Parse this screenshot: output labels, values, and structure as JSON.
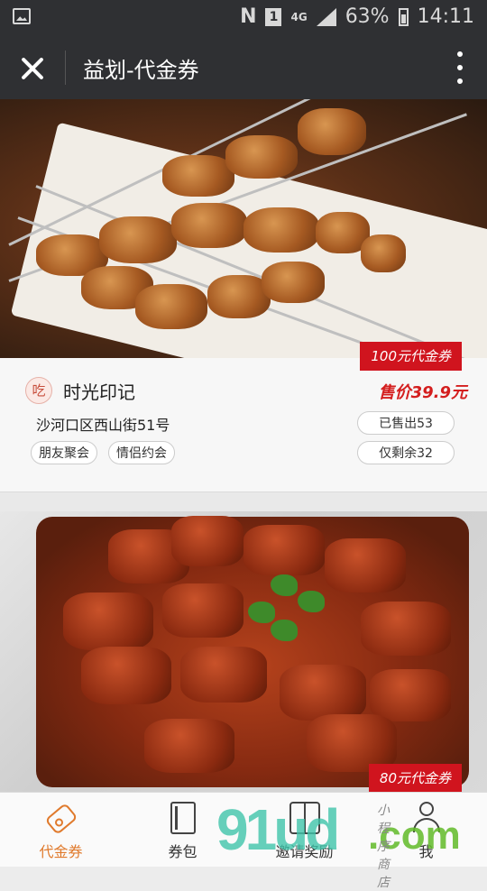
{
  "status_bar": {
    "carrier_glyph": "N",
    "sim_badge": "1",
    "network": "4G",
    "battery": "63%",
    "time": "14:11"
  },
  "nav": {
    "title": "益划-代金券",
    "close_icon": "close-icon",
    "more_icon": "more-vertical-icon"
  },
  "vouchers": [
    {
      "voucher_label": "100元代金券",
      "shop_icon_text": "吃",
      "shop_name": "时光印记",
      "price": "售价39.9元",
      "address": "沙河口区西山街51号",
      "sold": "已售出53",
      "remaining": "仅剩余32",
      "tags": [
        "朋友聚会",
        "情侣约会"
      ]
    },
    {
      "voucher_label": "80元代金券"
    }
  ],
  "tabs": [
    {
      "label": "代金券",
      "icon": "tag-icon",
      "active": true
    },
    {
      "label": "券包",
      "icon": "wallet-icon",
      "active": false
    },
    {
      "label": "邀请奖励",
      "icon": "gift-icon",
      "active": false
    },
    {
      "label": "我",
      "icon": "user-icon",
      "active": false
    }
  ],
  "watermark": {
    "main": "91ud",
    "suffix": ".com",
    "small": "小程序商店"
  },
  "colors": {
    "nav_bg": "#2f3033",
    "accent": "#d0141e",
    "active_tab": "#e07a2c"
  }
}
